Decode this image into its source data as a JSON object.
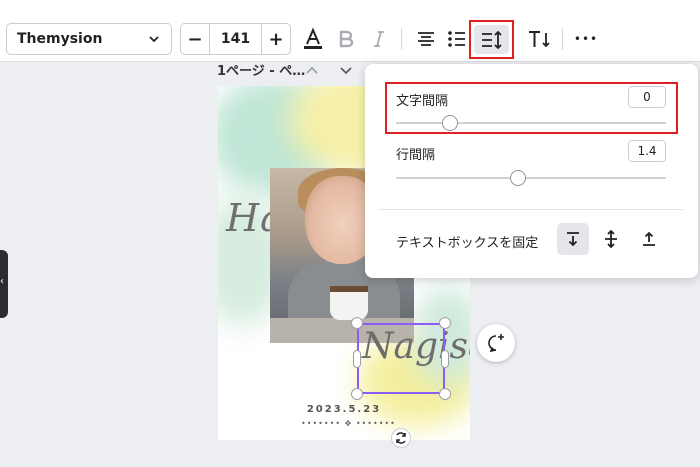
{
  "toolbar": {
    "font_name": "Themysion",
    "font_size": "141",
    "minus_label": "−",
    "plus_label": "+",
    "more_label": "•••"
  },
  "page_header": {
    "label": "1ページ - ペ…"
  },
  "design": {
    "title_text": "Happy Birth",
    "name_text": "Nagisa",
    "date_text": "2023.5.23",
    "ornament_text": "••••••• ✥ •••••••"
  },
  "spacing_panel": {
    "letter_spacing_label": "文字間隔",
    "letter_spacing_value": "0",
    "letter_spacing_slider": 0.2,
    "line_spacing_label": "行間隔",
    "line_spacing_value": "1.4",
    "line_spacing_slider": 0.45,
    "fix_textbox_label": "テキストボックスを固定"
  },
  "colors": {
    "highlight_red": "#e02020",
    "selection_purple": "#8b5cf6"
  }
}
